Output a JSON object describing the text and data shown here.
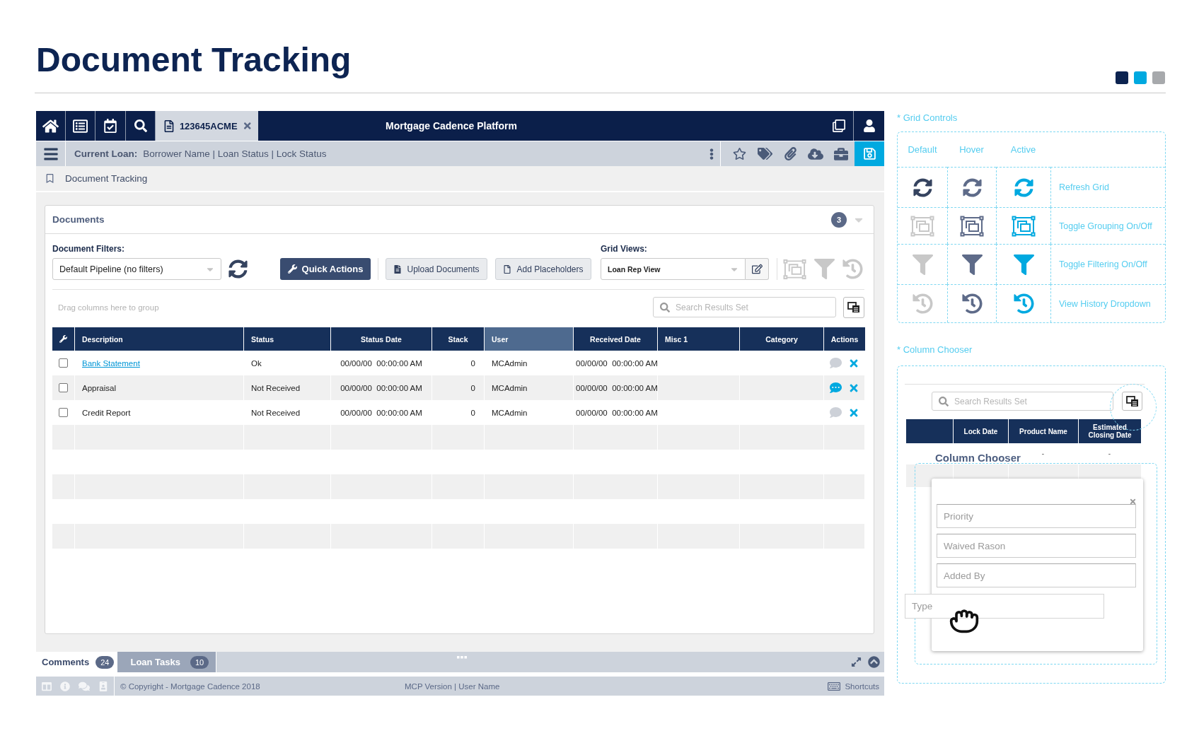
{
  "header": {
    "title": "Document Tracking",
    "swatches": [
      {
        "color": "#0c2350"
      },
      {
        "color": "#00a9e0"
      },
      {
        "color": "#a7a9ac"
      }
    ]
  },
  "top_bar": {
    "loan_tab": {
      "label": "123645ACME"
    },
    "title": "Mortgage Cadence Platform"
  },
  "loan_bar": {
    "label": "Current Loan:",
    "value": "Borrower Name | Loan Status | Lock Status"
  },
  "breadcrumb": {
    "label": "Document Tracking"
  },
  "documents_panel": {
    "title": "Documents",
    "count": "3",
    "filters": {
      "label": "Document Filters:",
      "value": "Default Pipeline (no filters)"
    },
    "actions": [
      {
        "label": "Quick Actions",
        "kind": "primary"
      },
      {
        "label": "Upload Documents",
        "kind": "upload"
      },
      {
        "label": "Add Placeholders",
        "kind": "placeholder"
      }
    ],
    "grid_views": {
      "label": "Grid Views:",
      "value": "Loan Rep View"
    },
    "group_hint": "Drag columns here to group",
    "search": {
      "placeholder": "Search Results Set"
    },
    "table": {
      "columns": [
        {
          "label": "Description",
          "selected": false
        },
        {
          "label": "Status",
          "selected": false
        },
        {
          "label": "Status Date",
          "selected": false
        },
        {
          "label": "Stack",
          "selected": false
        },
        {
          "label": "User",
          "selected": true
        },
        {
          "label": "Received Date",
          "selected": false
        },
        {
          "label": "Misc 1",
          "selected": false
        },
        {
          "label": "Category",
          "selected": false
        },
        {
          "label": "Actions",
          "selected": false
        }
      ],
      "rows": [
        {
          "checked": false,
          "description": "Bank Statement",
          "linked": true,
          "status": "Ok",
          "status_date": "00/00/00  00:00:00 AM",
          "stack": "0",
          "user": "MCAdmin",
          "received_date": "00/00/00  00:00:00 AM",
          "has_comments": false
        },
        {
          "checked": false,
          "description": "Appraisal",
          "linked": false,
          "status": "Not Received",
          "status_date": "00/00/00  00:00:00 AM",
          "stack": "0",
          "user": "MCAdmin",
          "received_date": "00/00/00  00:00:00 AM",
          "has_comments": true
        },
        {
          "checked": false,
          "description": "Credit Report",
          "linked": false,
          "status": "Not Received",
          "status_date": "00/00/00  00:00:00 AM",
          "stack": "0",
          "user": "MCAdmin",
          "received_date": "00/00/00  00:00:00 AM",
          "has_comments": false
        }
      ]
    }
  },
  "bottom_tabs": [
    {
      "label": "Comments",
      "count": "24",
      "selected": true
    },
    {
      "label": "Loan Tasks",
      "count": "10",
      "selected": false
    }
  ],
  "footer": {
    "copyright": "© Copyright - Mortgage Cadence 2018",
    "version": "MCP Version | User Name",
    "shortcuts": "Shortcuts"
  },
  "grid_controls": {
    "title": "* Grid Controls",
    "states": [
      {
        "label": "Default",
        "kind": "default"
      },
      {
        "label": "Hover",
        "kind": "hover"
      },
      {
        "label": "Active",
        "kind": "active"
      }
    ],
    "rows": [
      {
        "label": "Refresh Grid",
        "kind": "refresh"
      },
      {
        "label": "Toggle Grouping On/Off",
        "kind": "grouping"
      },
      {
        "label": "Toggle Filtering On/Off",
        "kind": "filter"
      },
      {
        "label": "View History Dropdown",
        "kind": "history"
      }
    ]
  },
  "column_chooser": {
    "title": "* Column Chooser",
    "search": {
      "placeholder": "Search Results Set"
    },
    "columns": [
      {
        "label": "Lock Date"
      },
      {
        "label": "Product Name"
      },
      {
        "label": "Estimated Closing Date"
      }
    ],
    "row_cells": [
      "-",
      "-"
    ],
    "dialog": {
      "title": "Column Chooser",
      "items": [
        {
          "label": "Priority"
        },
        {
          "label": "Waived Rason"
        },
        {
          "label": "Added By"
        }
      ],
      "dragged_item": {
        "label": "Type"
      }
    }
  }
}
